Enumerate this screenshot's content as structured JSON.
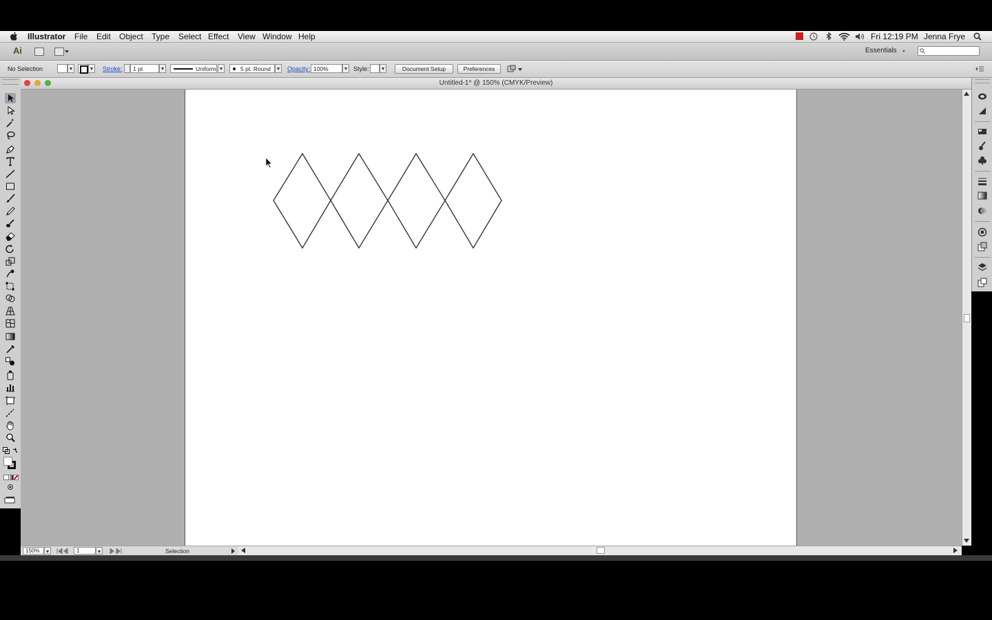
{
  "menubar": {
    "app_name": "Illustrator",
    "items": [
      "File",
      "Edit",
      "Object",
      "Type",
      "Select",
      "Effect",
      "View",
      "Window",
      "Help"
    ],
    "clock": "Fri 12:19 PM",
    "user": "Jenna Frye"
  },
  "appbar": {
    "logo": "Ai",
    "workspace": "Essentials",
    "search_placeholder": ""
  },
  "controlbar": {
    "selection": "No Selection",
    "stroke_label": "Stroke:",
    "stroke_weight": "1 pt",
    "stroke_profile": "Uniform",
    "brush": "5 pt. Round",
    "opacity_label": "Opacity:",
    "opacity": "100%",
    "style_label": "Style:",
    "document_setup": "Document Setup",
    "preferences": "Preferences"
  },
  "document": {
    "title": "Untitled-1* @ 150% (CMYK/Preview)",
    "zoom": "150%",
    "artboard_number": "1",
    "status": "Selection"
  },
  "colors": {
    "close": "#e0443e",
    "minimize": "#e0a83a",
    "zoom": "#55b43f",
    "stroke": "#2a2a2a"
  }
}
